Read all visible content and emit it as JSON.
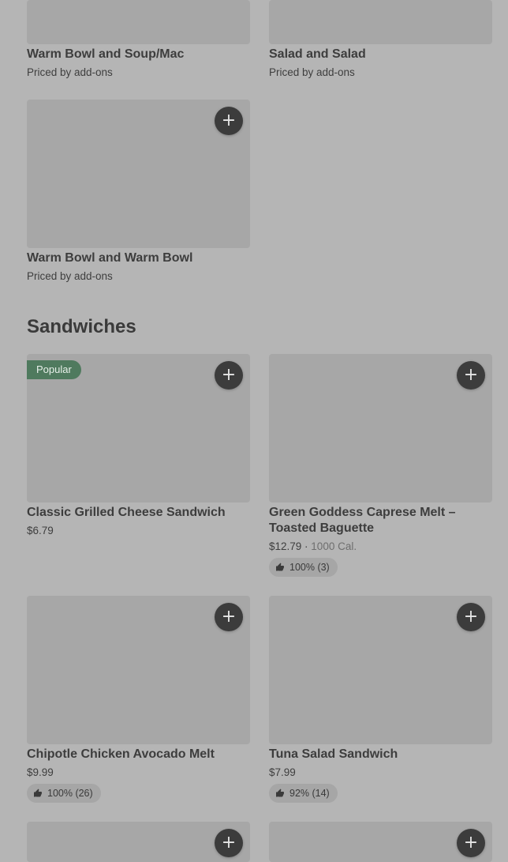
{
  "top_cards": [
    {
      "name": "Warm Bowl and Soup/Mac",
      "price_note": "Priced by add-ons"
    },
    {
      "name": "Salad and Salad",
      "price_note": "Priced by add-ons"
    },
    {
      "name": "Warm Bowl and Warm Bowl",
      "price_note": "Priced by add-ons"
    }
  ],
  "add_icon": "+",
  "section": {
    "title": "Sandwiches"
  },
  "sandwiches": [
    {
      "name": "Classic Grilled Cheese Sandwich",
      "price": "$6.79",
      "badge": "Popular"
    },
    {
      "name": "Green Goddess Caprese Melt – Toasted Baguette",
      "price": "$12.79",
      "separator": " · ",
      "calories": "1000 Cal.",
      "rating": "100% (3)"
    },
    {
      "name": "Chipotle Chicken Avocado Melt",
      "price": "$9.99",
      "rating": "100% (26)"
    },
    {
      "name": "Tuna Salad Sandwich",
      "price": "$7.99",
      "rating": "92% (14)"
    }
  ],
  "icons": {
    "add": "plus-icon",
    "rating": "thumbs-up-icon"
  }
}
